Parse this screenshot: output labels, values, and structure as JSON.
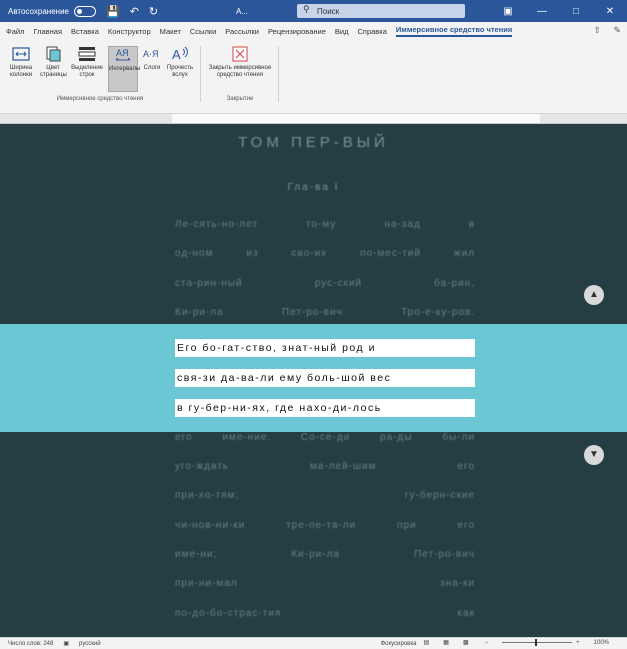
{
  "titlebar": {
    "autosave_label": "Автосохранение",
    "doc_name": "A...",
    "search_label": "Поиск"
  },
  "tabs": [
    {
      "label": "Файл"
    },
    {
      "label": "Главная"
    },
    {
      "label": "Вставка"
    },
    {
      "label": "Конструктор"
    },
    {
      "label": "Макет"
    },
    {
      "label": "Ссылки"
    },
    {
      "label": "Рассылки"
    },
    {
      "label": "Рецензирование"
    },
    {
      "label": "Вид"
    },
    {
      "label": "Справка"
    },
    {
      "label": "Иммерсивное средство чтения"
    }
  ],
  "ribbon": {
    "column_width": "Ширина колонки",
    "page_color": "Цвет страницы",
    "line_focus": "Выделение строк",
    "intervals": "Интервалы",
    "syllables": "Слоги",
    "read_aloud": "Прочесть вслух",
    "close_reader": "Закрыть иммерсивное средство чтения",
    "group_reader": "Иммерсивное средство чтения",
    "group_close": "Закрытие"
  },
  "document": {
    "heading": "ТОМ ПЕР-ВЫЙ",
    "chapter": "Гла-ва I",
    "lines_before": [
      "Ле-сять-но-лет то-му на-зад в",
      "од-ном из сво-их по-мес-тий жил",
      "ста-рин-ный рус-ский ба-рин,",
      "Ки-ри-ла Пет-ро-вич Тро-е-ку-ров."
    ],
    "focus_lines": [
      "Его бо-гат-ство, знат-ный род и",
      "свя-зи да-ва-ли ему боль-шой вес",
      "в гу-бер-ни-ях, где нахо-ди-лось"
    ],
    "lines_after": [
      "его име-ние. Со-се-ди ра-ды бы-ли",
      "уго-ждать ма-лей-шим его",
      "при-хо-тям; гу-берн-ские",
      "чи-нов-ни-ки тре-пе-та-ли при его",
      "име-ни; Ки-ри-ла Пет-ро-вич",
      "при-ни-мал зна-ки",
      "по-до-бо-страс-тия как"
    ]
  },
  "status": {
    "word_count": "Число слов: 248",
    "language": "русский",
    "focus": "Фокусировка",
    "zoom": "100%"
  }
}
